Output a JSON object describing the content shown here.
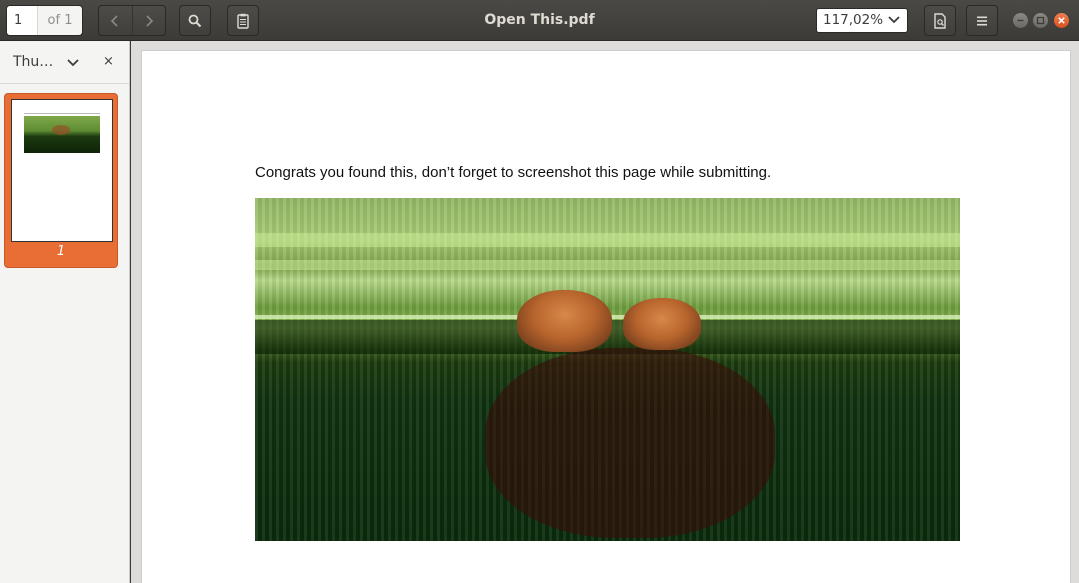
{
  "window": {
    "title": "Open This.pdf"
  },
  "toolbar": {
    "current_page": "1",
    "page_total": "of 1",
    "zoom": "117,02%"
  },
  "sidebar": {
    "title": "Thu…",
    "close_glyph": "×",
    "thumbnails": [
      {
        "label": "1"
      }
    ]
  },
  "document": {
    "text": "Congrats you found this, don’t forget to screenshot this page while submitting."
  },
  "icons": {
    "prev": "chevron-left-icon",
    "next": "chevron-right-icon",
    "search": "search-icon",
    "annotations": "clipboard-icon",
    "properties": "document-properties-icon",
    "menu": "hamburger-menu-icon"
  },
  "colors": {
    "headerbar": "#3c3b37",
    "accent": "#e96e35",
    "close_button": "#e95420"
  }
}
